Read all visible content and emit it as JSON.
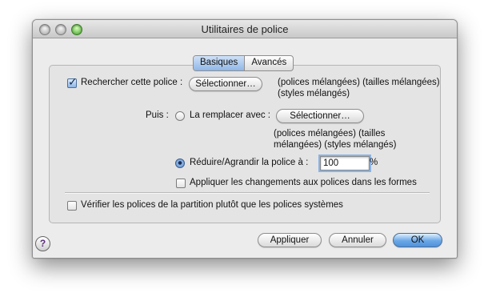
{
  "window": {
    "title": "Utilitaires de police"
  },
  "tabs": {
    "basic": "Basiques",
    "advanced": "Avancés"
  },
  "search": {
    "label": "Rechercher cette police :",
    "select_button": "Sélectionner…",
    "desc_line1": "(polices mélangées) (tailles mélangées)",
    "desc_line2": "(styles mélangés)"
  },
  "replace": {
    "puis": "Puis :",
    "label": "La remplacer avec :",
    "select_button": "Sélectionner…",
    "desc_line1": "(polices mélangées) (tailles",
    "desc_line2": "mélangées)  (styles mélangés)"
  },
  "resize": {
    "label": "Réduire/Agrandir la police à :",
    "value": "100",
    "unit": "%"
  },
  "apply_forms": {
    "label": "Appliquer les changements aux polices dans les formes"
  },
  "verify": {
    "label": "Vérifier les polices de la partition plutôt que les polices systèmes"
  },
  "footer": {
    "help": "?",
    "apply": "Appliquer",
    "cancel": "Annuler",
    "ok": "OK"
  }
}
